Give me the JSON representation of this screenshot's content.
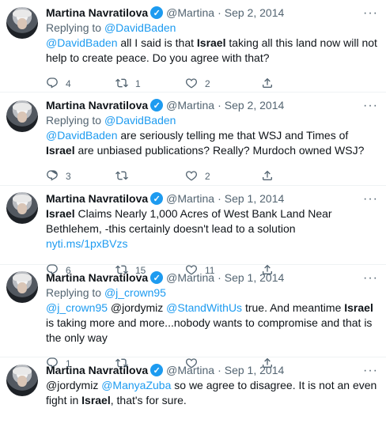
{
  "tweets": [
    {
      "name": "Martina Navratilova",
      "handle": "@Martina",
      "date": "Sep 2, 2014",
      "reply_prefix": "Replying to ",
      "reply_to": "@DavidBaden",
      "segments": [
        {
          "t": "@DavidBaden",
          "s": "mention"
        },
        {
          "t": " all I said is that ",
          "s": ""
        },
        {
          "t": "Israel",
          "s": "bold"
        },
        {
          "t": " taking all this land now will not help to create peace. Do you agree with that?",
          "s": ""
        }
      ],
      "replies": "4",
      "retweets": "1",
      "likes": "2"
    },
    {
      "name": "Martina Navratilova",
      "handle": "@Martina",
      "date": "Sep 2, 2014",
      "reply_prefix": "Replying to ",
      "reply_to": "@DavidBaden",
      "segments": [
        {
          "t": "@DavidBaden",
          "s": "mention"
        },
        {
          "t": " are seriously telling me that WSJ and Times of ",
          "s": ""
        },
        {
          "t": "Israel",
          "s": "bold"
        },
        {
          "t": " are unbiased publications? Really? Murdoch owned WSJ?",
          "s": ""
        }
      ],
      "replies": "3",
      "retweets": "",
      "likes": "2"
    },
    {
      "name": "Martina Navratilova",
      "handle": "@Martina",
      "date": "Sep 1, 2014",
      "reply_prefix": "",
      "reply_to": "",
      "segments": [
        {
          "t": "Israel",
          "s": "bold"
        },
        {
          "t": " Claims Nearly 1,000 Acres of West Bank Land Near Bethlehem, -this certainly doesn't lead to a solution ",
          "s": ""
        },
        {
          "t": "nyti.ms/1pxBVzs",
          "s": "link"
        }
      ],
      "replies": "6",
      "retweets": "15",
      "likes": "11"
    },
    {
      "name": "Martina Navratilova",
      "handle": "@Martina",
      "date": "Sep 1, 2014",
      "reply_prefix": "Replying to ",
      "reply_to": "@j_crown95",
      "segments": [
        {
          "t": "@j_crown95",
          "s": "mention"
        },
        {
          "t": " @jordymiz ",
          "s": ""
        },
        {
          "t": "@StandWithUs",
          "s": "mention"
        },
        {
          "t": " true. And meantime ",
          "s": ""
        },
        {
          "t": "Israel",
          "s": "bold"
        },
        {
          "t": " is taking more and more...nobody wants to compromise and that is the only way",
          "s": ""
        }
      ],
      "replies": "1",
      "retweets": "",
      "likes": ""
    },
    {
      "name": "Martina Navratilova",
      "handle": "@Martina",
      "date": "Sep 1, 2014",
      "reply_prefix": "",
      "reply_to": "",
      "segments": [
        {
          "t": "@jordymiz ",
          "s": ""
        },
        {
          "t": "@ManyaZuba",
          "s": "mention"
        },
        {
          "t": " so we agree to disagree. It is not an even fight in ",
          "s": ""
        },
        {
          "t": "Israel",
          "s": "bold"
        },
        {
          "t": ", that's for sure.",
          "s": ""
        }
      ],
      "replies": "",
      "retweets": "",
      "likes": ""
    }
  ],
  "icons": {
    "verified": "verified-badge-icon",
    "more": "more-icon",
    "reply": "reply-icon",
    "retweet": "retweet-icon",
    "like": "heart-icon",
    "share": "share-icon"
  },
  "colors": {
    "accent": "#1d9bf0",
    "text": "#0f1419",
    "secondary": "#536471",
    "divider": "#eff3f4"
  }
}
